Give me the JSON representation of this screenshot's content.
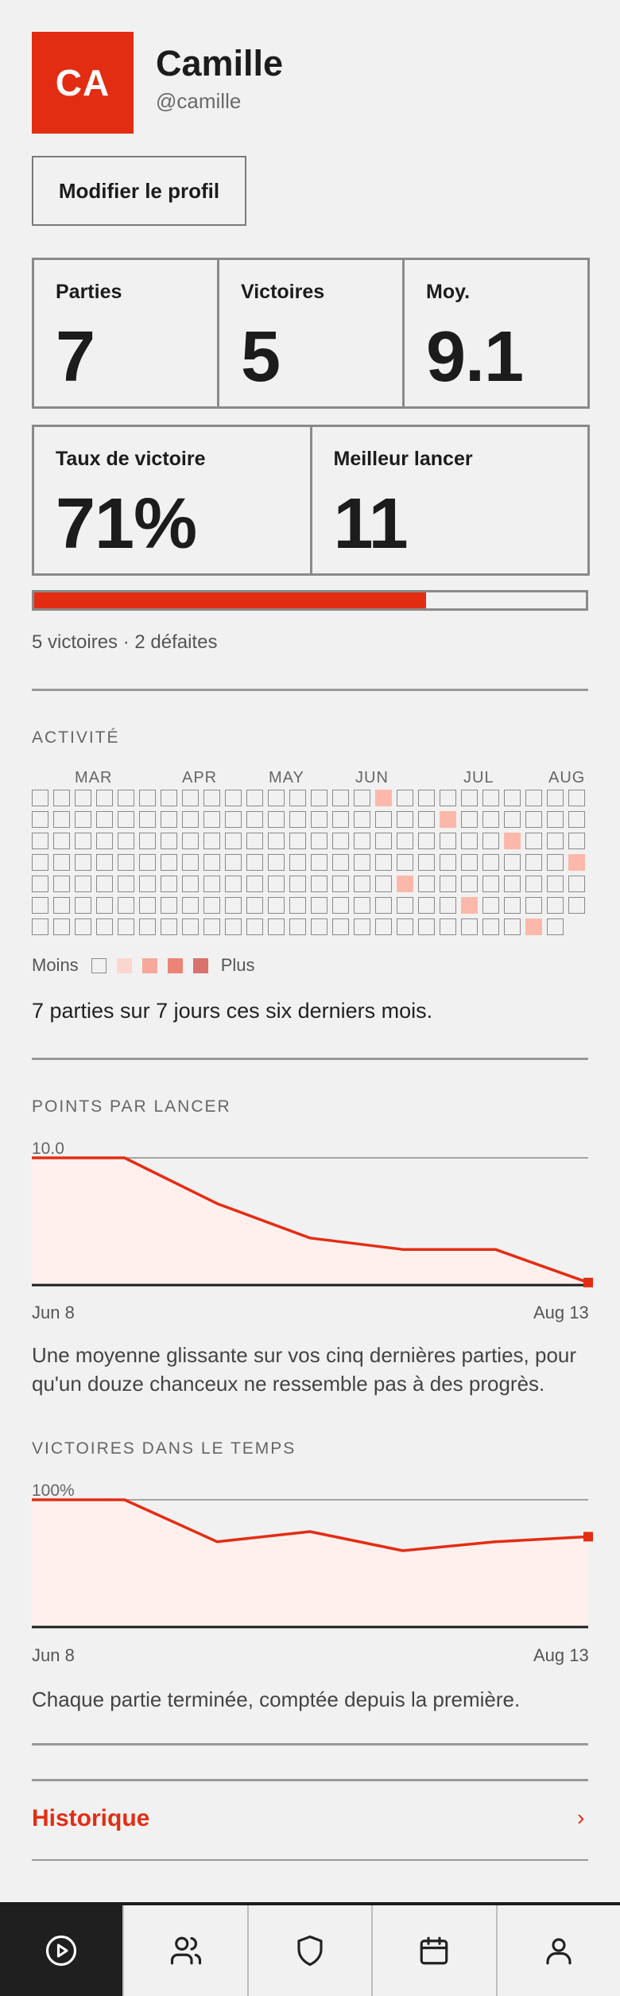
{
  "profile": {
    "initials": "CA",
    "name": "Camille",
    "handle": "@camille",
    "edit_label": "Modifier le profil"
  },
  "stats_row1": [
    {
      "label": "Parties",
      "value": "7"
    },
    {
      "label": "Victoires",
      "value": "5"
    },
    {
      "label": "Moy.",
      "value": "9.1"
    }
  ],
  "stats_row2": [
    {
      "label": "Taux de victoire",
      "value": "71%"
    },
    {
      "label": "Meilleur lancer",
      "value": "11"
    }
  ],
  "win_progress": 0.71,
  "record_text": "5 victoires · 2 défaites",
  "activity": {
    "title": "ACTIVITÉ",
    "months": [
      "MAR",
      "APR",
      "MAY",
      "JUN",
      "JUL",
      "AUG"
    ],
    "legend_less": "Moins",
    "legend_more": "Plus",
    "summary": "7 parties sur 7 jours ces six derniers mois.",
    "active_days": [
      {
        "week": 16,
        "day": 0
      },
      {
        "week": 19,
        "day": 1
      },
      {
        "week": 22,
        "day": 2
      },
      {
        "week": 25,
        "day": 3
      },
      {
        "week": 17,
        "day": 4
      },
      {
        "week": 20,
        "day": 5
      },
      {
        "week": 23,
        "day": 6
      }
    ]
  },
  "points_chart": {
    "title": "POINTS PAR LANCER",
    "ymax_label": "10.0",
    "x_start": "Jun 8",
    "x_end": "Aug 13",
    "caption": "Une moyenne glissante sur vos cinq dernières parties, pour qu'un douze chanceux ne ressemble pas à des progrès."
  },
  "wins_chart": {
    "title": "VICTOIRES DANS LE TEMPS",
    "ymax_label": "100%",
    "x_start": "Jun 8",
    "x_end": "Aug 13",
    "caption": "Chaque partie terminée, comptée depuis la première."
  },
  "chart_data": [
    {
      "type": "area",
      "title": "POINTS PAR LANCER",
      "x": [
        "Jun 8",
        "",
        "",
        "",
        "",
        "",
        "Aug 13"
      ],
      "values": [
        10.0,
        10.0,
        6.4,
        3.7,
        2.8,
        2.8,
        0.2
      ],
      "ylim": [
        0,
        10
      ]
    },
    {
      "type": "area",
      "title": "VICTOIRES DANS LE TEMPS",
      "x": [
        "Jun 8",
        "",
        "",
        "",
        "",
        "",
        "Aug 13"
      ],
      "values": [
        100,
        100,
        67,
        75,
        60,
        67,
        71
      ],
      "ylim": [
        0,
        100
      ]
    }
  ],
  "history": {
    "label": "Historique",
    "chevron": "›"
  },
  "nav": [
    {
      "icon": "play-circle-icon"
    },
    {
      "icon": "users-icon"
    },
    {
      "icon": "shield-icon"
    },
    {
      "icon": "calendar-icon"
    },
    {
      "icon": "user-icon"
    }
  ],
  "colors": {
    "accent": "#e32d13",
    "area_fill": "#fff0ee"
  }
}
